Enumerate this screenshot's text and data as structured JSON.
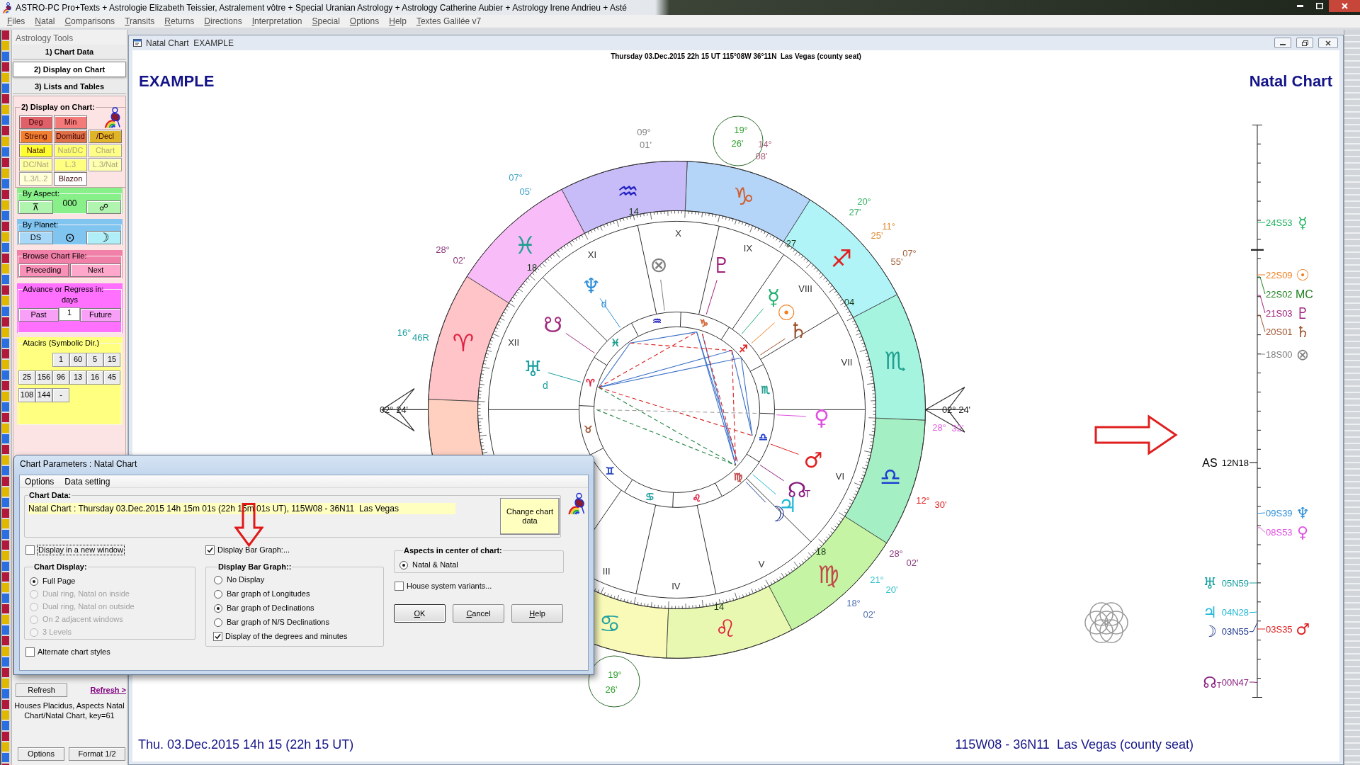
{
  "window": {
    "title": "ASTRO-PC Pro+Texts + Astrologie Elizabeth Teissier, Astralement vôtre + Special Uranian Astrology + Astrology Catherine Aubier + Astrology Irene Andrieu + Asté"
  },
  "menu": [
    "Files",
    "Natal",
    "Comparisons",
    "Transits",
    "Returns",
    "Directions",
    "Interpretation",
    "Special",
    "Options",
    "Help",
    "Textes Galilée v7"
  ],
  "sidebar": {
    "title": "Astrology Tools",
    "tabs": [
      {
        "label": "1) Chart Data",
        "selected": false
      },
      {
        "label": "2) Display on Chart",
        "selected": true
      },
      {
        "label": "3) Lists and Tables",
        "selected": false
      }
    ],
    "display_group": {
      "title": "2) Display on Chart:",
      "buttons": [
        {
          "label": "Deg",
          "color": "#e0606a",
          "disabled": false
        },
        {
          "label": "Min",
          "color": "#f47a7a",
          "disabled": false
        },
        {
          "label": "Streng",
          "color": "#f07f30",
          "disabled": false
        },
        {
          "label": "Domitud",
          "color": "#e07048",
          "disabled": false
        },
        {
          "label": "/Decl",
          "color": "#e0b428",
          "disabled": false
        },
        {
          "label": "Natal",
          "color": "#ffff30",
          "disabled": false
        },
        {
          "label": "Nat/DC",
          "color": "#ffff70",
          "disabled": true
        },
        {
          "label": "Chart",
          "color": "#ffff88",
          "disabled": true
        },
        {
          "label": "DC/Nat",
          "color": "#ffffa0",
          "disabled": true
        },
        {
          "label": "L.3",
          "color": "#ffff80",
          "disabled": true
        },
        {
          "label": "L.3/Nat",
          "color": "#ffffb0",
          "disabled": true
        },
        {
          "label": "L.3/L.2",
          "color": "#ffffd8",
          "disabled": true
        },
        {
          "label": "Blazon",
          "color": "#ffffff",
          "disabled": false
        }
      ]
    },
    "aspect_group": {
      "title": "By Aspect:",
      "color": "#88f088",
      "buttons": [
        "⊼",
        "☍"
      ],
      "value": "000"
    },
    "planet_group": {
      "title": "By Planet:",
      "color": "#80c4f0",
      "buttons": [
        "DS",
        "☽"
      ],
      "value": "⊙"
    },
    "browse_group": {
      "title": "Browse Chart File:",
      "color": "#f080a8",
      "buttons": [
        "Preceding",
        "Next"
      ]
    },
    "advance_group": {
      "title": "Advance or Regress in:",
      "unit": "days",
      "color": "#ff70ff",
      "buttons": [
        "Past",
        "Future"
      ],
      "field": {
        "value": "1"
      }
    },
    "atacirs_group": {
      "title": "Atacirs (Symbolic Dir.)",
      "color": "#ffff80",
      "buttons": [
        "1",
        "60",
        "5",
        "15",
        "25",
        "156",
        "96",
        "13",
        "16",
        "45",
        "108",
        "144",
        "-"
      ]
    },
    "refresh": {
      "button": "Refresh",
      "link": "Refresh >"
    },
    "info": "Houses Placidus, Aspects Natal Chart/Natal Chart, key=61",
    "bottom_buttons": [
      "Options",
      "Format 1/2"
    ]
  },
  "chart_window": {
    "title": "Natal Chart  EXAMPLE",
    "header": "Thursday 03.Dec.2015 22h 15 UT 115°08W 36°11N  Las Vegas (county seat)",
    "name": "EXAMPLE",
    "chart_type": "Natal Chart",
    "footer_left": "Thu. 03.Dec.2015 14h 15 (22h 15 UT)",
    "footer_right": "115W08 - 36N11  Las Vegas (county seat)",
    "wheel": {
      "signs": [
        {
          "color": "#fafab8",
          "symbol": {
            "glyph": "♋",
            "color": "#20a0a0"
          }
        },
        {
          "color": "#e8f8b0",
          "symbol": {
            "glyph": "♌",
            "color": "#e02040"
          }
        },
        {
          "color": "#c4f4a4",
          "symbol": {
            "glyph": "♍",
            "color": "#c04848"
          }
        },
        {
          "color": "#a4f0c4",
          "symbol": {
            "glyph": "♎",
            "color": "#2040d0"
          }
        },
        {
          "color": "#a4f4e0",
          "symbol": {
            "glyph": "♏",
            "color": "#20a090"
          }
        },
        {
          "color": "#b0f4f8",
          "symbol": {
            "glyph": "♐",
            "color": "#e02020"
          }
        },
        {
          "color": "#b4d4f8",
          "symbol": {
            "glyph": "♑",
            "color": "#d06030"
          }
        },
        {
          "color": "#c8bcf8",
          "symbol": {
            "glyph": "♒",
            "color": "#2020c0"
          }
        },
        {
          "color": "#f8bcf8",
          "symbol": {
            "glyph": "♓",
            "color": "#20a090"
          }
        },
        {
          "color": "#ffc4c8",
          "symbol": {
            "glyph": "♈",
            "color": "#e02040"
          }
        },
        {
          "color": "#ffd0c0"
        }
      ],
      "inner_signs": [
        {
          "glyph": "♈",
          "color": "#e02040"
        },
        {
          "glyph": "♉",
          "color": "#a06040"
        },
        {
          "glyph": "♊",
          "color": "#2040c0"
        },
        {
          "glyph": "♋",
          "color": "#20a0a0"
        },
        {
          "glyph": "♌",
          "color": "#e02040"
        },
        {
          "glyph": "♍",
          "color": "#c04848"
        },
        {
          "glyph": "♎",
          "color": "#2040d0"
        },
        {
          "glyph": "♏",
          "color": "#20a090"
        },
        {
          "glyph": "♐",
          "color": "#e02020"
        },
        {
          "glyph": "♑",
          "color": "#d06030"
        },
        {
          "glyph": "♒",
          "color": "#2020c0"
        },
        {
          "glyph": "♓",
          "color": "#20a090"
        }
      ],
      "houses": [
        "III",
        "IV",
        "V",
        "VI",
        "VII",
        "VIII",
        "IX",
        "X",
        "XI",
        "XII"
      ],
      "cusp_marks": [
        "14",
        "27",
        "18",
        "04",
        "18",
        "14"
      ],
      "degree_labels": [
        {
          "degree": "09°",
          "minute": "01'",
          "color": "#808080",
          "kind": "plain"
        },
        {
          "degree": "19°",
          "minute": "26'",
          "color": "#30a030",
          "kind": "circled"
        },
        {
          "degree": "14°",
          "minute": "08'",
          "color": "#b06080",
          "kind": "plain"
        },
        {
          "degree": "07°",
          "minute": "05'",
          "color": "#3aa0c8",
          "kind": "plain"
        },
        {
          "degree": "20°",
          "minute": "27'",
          "color": "#30b060",
          "kind": "plain"
        },
        {
          "degree": "11°",
          "minute": "25'",
          "color": "#e08a30",
          "kind": "plain"
        },
        {
          "degree": "07°",
          "minute": "55'",
          "color": "#a0603a",
          "kind": "plain"
        },
        {
          "degree": "28°",
          "minute": "02'",
          "color": "#8a3a7a",
          "kind": "plain"
        },
        {
          "degree": "16°",
          "minute": "46R",
          "color": "#20a0a0",
          "kind": "plain"
        },
        {
          "degree": "28°",
          "minute": "32'",
          "color": "#e060e0",
          "kind": "plain"
        },
        {
          "degree": "12°",
          "minute": "30'",
          "color": "#e02020",
          "kind": "plain"
        },
        {
          "degree": "28°",
          "minute": "02'",
          "color": "#8a3a7a",
          "kind": "plain"
        },
        {
          "degree": "21°",
          "minute": "20'",
          "color": "#30c0c8",
          "kind": "plain"
        },
        {
          "degree": "18°",
          "minute": "02'",
          "color": "#5070b0",
          "kind": "plain"
        },
        {
          "degree": "19°",
          "minute": "26'",
          "color": "#30a030",
          "kind": "circled"
        }
      ],
      "angles": [
        "02° 24'",
        "02° 24'"
      ],
      "planets": [
        {
          "glyph": "⊗",
          "color": "#808080"
        },
        {
          "glyph": "♇",
          "color": "#a0207a"
        },
        {
          "glyph": "♆",
          "note": "d",
          "color": "#2e8fd8"
        },
        {
          "glyph": "☿",
          "color": "#20b070"
        },
        {
          "glyph": "☉",
          "color": "#f08020"
        },
        {
          "glyph": "☋",
          "color": "#a03080"
        },
        {
          "glyph": "♄",
          "color": "#a0522d"
        },
        {
          "glyph": "♅",
          "note": "d",
          "color": "#1aa0a0"
        },
        {
          "glyph": "♀",
          "color": "#e050e0"
        },
        {
          "glyph": "♂",
          "color": "#e02020"
        },
        {
          "glyph": "☊",
          "note": "T",
          "color": "#8a2080"
        },
        {
          "glyph": "♃",
          "color": "#20b8d8"
        },
        {
          "glyph": "☽",
          "color": "#203890"
        }
      ]
    },
    "declinations": [
      {
        "kind": "south",
        "label": "24S53",
        "symbol": {
          "kind": "glyph",
          "text": "☿"
        },
        "color": "#20b060"
      },
      {
        "kind": "south",
        "label": "22S09",
        "symbol": {
          "kind": "glyph",
          "text": "☉"
        },
        "color": "#f08020"
      },
      {
        "kind": "south",
        "label": "22S02",
        "symbol": {
          "kind": "letters",
          "text": "MC"
        },
        "color": "#208020"
      },
      {
        "kind": "south",
        "label": "21S03",
        "symbol": {
          "kind": "glyph",
          "text": "♇"
        },
        "color": "#a0207a"
      },
      {
        "kind": "south",
        "label": "20S01",
        "symbol": {
          "kind": "glyph",
          "text": "♄"
        },
        "color": "#a0522d"
      },
      {
        "kind": "south",
        "label": "18S00",
        "symbol": {
          "kind": "glyph",
          "text": "⊗"
        },
        "color": "#808080"
      },
      {
        "kind": "north",
        "label": "12N18",
        "symbol": {
          "kind": "letters",
          "text": "AS"
        },
        "color": "#000000"
      },
      {
        "kind": "south",
        "label": "09S39",
        "symbol": {
          "kind": "glyph",
          "text": "♆"
        },
        "color": "#2e8fd8"
      },
      {
        "kind": "south",
        "label": "08S53",
        "symbol": {
          "kind": "glyph",
          "text": "♀"
        },
        "color": "#e050e0"
      },
      {
        "kind": "north",
        "label": "05N59",
        "symbol": {
          "kind": "glyph",
          "text": "♅"
        },
        "color": "#1aa0a0"
      },
      {
        "kind": "north",
        "label": "04N28",
        "symbol": {
          "kind": "glyph",
          "text": "♃"
        },
        "color": "#20b8d8"
      },
      {
        "kind": "north",
        "label": "03N55",
        "symbol": {
          "kind": "glyph",
          "text": "☽"
        },
        "color": "#203890"
      },
      {
        "kind": "south",
        "label": "03S35",
        "symbol": {
          "kind": "glyph",
          "text": "♂"
        },
        "color": "#e02020"
      },
      {
        "kind": "north",
        "label": "00N47",
        "symbol": {
          "kind": "glyph",
          "text": "☊"
        },
        "note": "T",
        "color": "#8a2080"
      }
    ]
  },
  "dialog": {
    "title": "Chart Parameters : Natal Chart",
    "menu": [
      "Options",
      "Data setting"
    ],
    "data_box": {
      "title": "Chart Data:",
      "value": "Natal Chart : Thursday 03.Dec.2015 14h 15m 01s (22h 15m 01s UT), 115W08 - 36N11  Las Vegas",
      "button": "Change chart data"
    },
    "new_window": {
      "label": "Display in a new window",
      "checked": false,
      "focused": true
    },
    "chart_display": {
      "title": "Chart Display:",
      "options": [
        {
          "label": "Full Page",
          "selected": true,
          "disabled": false
        },
        {
          "label": "Dual ring, Natal on inside",
          "selected": false,
          "disabled": true
        },
        {
          "label": "Dual ring, Natal on outside",
          "selected": false,
          "disabled": true
        },
        {
          "label": "On 2 adjacent windows",
          "selected": false,
          "disabled": true
        },
        {
          "label": "3 Levels",
          "selected": false,
          "disabled": true
        }
      ]
    },
    "alternate_styles": {
      "label": "Alternate chart styles",
      "checked": false
    },
    "bar_graph": {
      "label": "Display Bar Graph:...",
      "checked": true
    },
    "bar_graph_display": {
      "title": "Display Bar Graph::",
      "options": [
        {
          "label": "No Display",
          "selected": false
        },
        {
          "label": "Bar graph of Longitudes",
          "selected": false
        },
        {
          "label": "Bar graph of Declinations",
          "selected": true
        },
        {
          "label": "Bar graph of N/S Declinations",
          "selected": false
        }
      ],
      "degrees": {
        "label": "Display of the degrees and minutes",
        "checked": true
      }
    },
    "aspects_center": {
      "title": "Aspects in center of chart:",
      "options": [
        {
          "label": "Natal & Natal",
          "selected": true
        }
      ]
    },
    "house_variants": {
      "label": "House system variants...",
      "checked": false
    },
    "buttons": [
      "OK",
      "Cancel",
      "Help"
    ]
  }
}
